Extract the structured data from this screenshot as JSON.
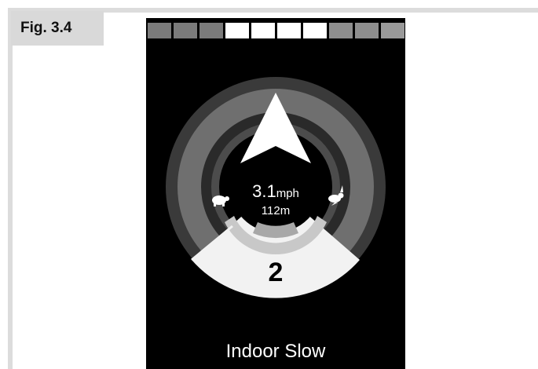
{
  "figure": {
    "label": "Fig. 3.4"
  },
  "display": {
    "speed_level_bar": {
      "segments_total": 10,
      "highlighted_segments": [
        4,
        5,
        6,
        7
      ],
      "colors": {
        "inactive": "#8a8a8a",
        "active": "#ffffff",
        "inactive_dark": "#6e6e6e"
      }
    },
    "gauge": {
      "direction_icon": "up-arrow-icon",
      "slow_icon": "turtle-icon",
      "fast_icon": "rabbit-icon",
      "outer_ring_color": "#7a7a7a",
      "inner_ring_color": "#5a5a5a",
      "highlight_color": "#ffffff"
    },
    "speed": {
      "value": "3.1",
      "unit": "mph"
    },
    "distance": "112m",
    "profile_number": "2",
    "profile_name": "Indoor Slow"
  }
}
